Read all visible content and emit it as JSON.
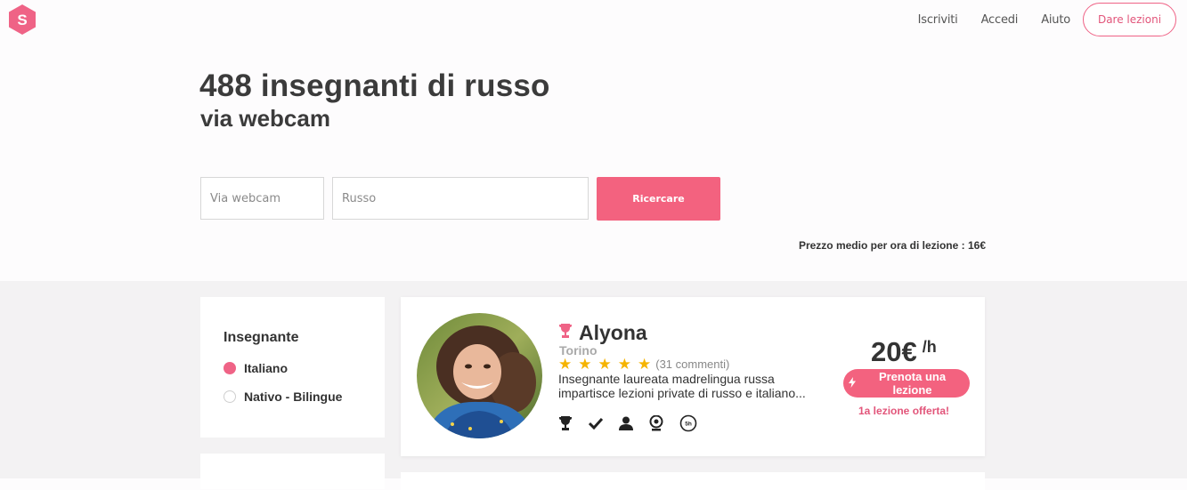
{
  "header": {
    "logo_letter": "S",
    "brand_color": "#ef6386",
    "nav": [
      "Iscriviti",
      "Accedi",
      "Aiuto"
    ],
    "cta_label": "Dare lezioni"
  },
  "hero": {
    "title": "488 insegnanti di russo",
    "subtitle": "via webcam"
  },
  "search": {
    "mode_placeholder": "Via webcam",
    "subject_placeholder": "Russo",
    "button_label": "Ricercare",
    "avg_price": "Prezzo medio per ora di lezione : 16€"
  },
  "filters": {
    "title": "Insegnante",
    "options": [
      {
        "label": "Italiano",
        "selected": true
      },
      {
        "label": "Nativo - Bilingue",
        "selected": false
      }
    ]
  },
  "teacher": {
    "name": "Alyona",
    "city": "Torino",
    "rating": 5,
    "reviews": "(31 commenti)",
    "description": "Insegnante laureata madrelingua russa impartisce lezioni private di russo e italiano...",
    "badges": [
      "trophy-icon",
      "check-icon",
      "person-icon",
      "webcam-icon",
      "hours-icon"
    ],
    "hours_badge_text": "5h",
    "price": "20€",
    "price_unit": "/h",
    "book_label": "Prenota una lezione",
    "offer": "1a lezione offerta!"
  }
}
